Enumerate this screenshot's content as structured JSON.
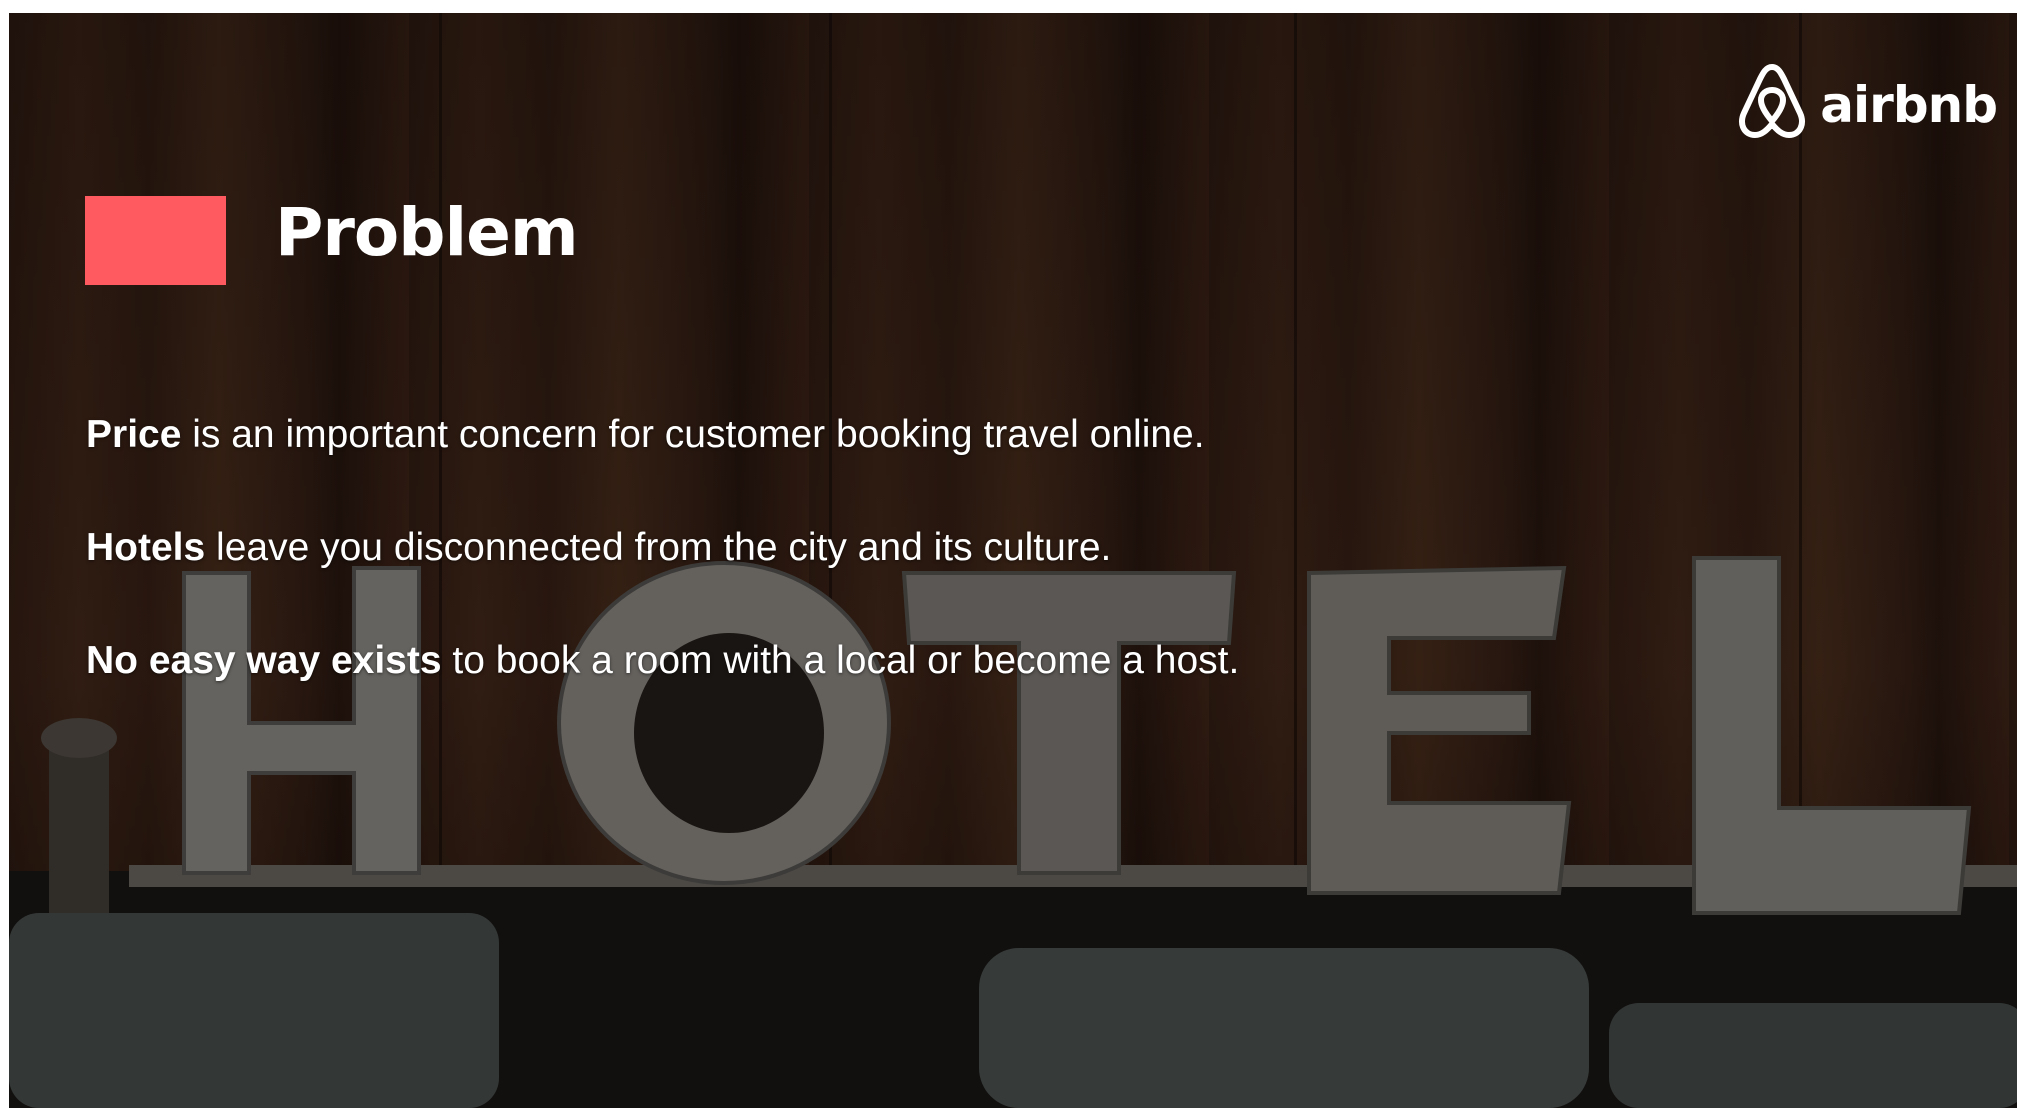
{
  "logo": {
    "text": "airbnb",
    "icon": "airbnb-belo-icon"
  },
  "title": "Problem",
  "accent_color": "#ff5a5f",
  "points": [
    {
      "bold": "Price",
      "rest": " is an important concern for customer booking travel online."
    },
    {
      "bold": "Hotels",
      "rest": " leave you disconnected from the city and its culture."
    },
    {
      "bold": "No easy way exists",
      "rest": " to book a room with a local or become a host."
    }
  ],
  "background_sign": "HOTEL"
}
